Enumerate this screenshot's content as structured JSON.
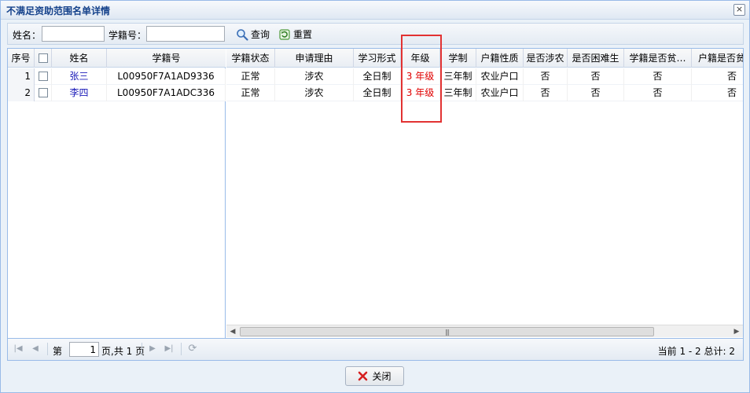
{
  "dialog": {
    "title": "不满足资助范围名单详情",
    "close_icon": "×"
  },
  "search": {
    "name_label": "姓名：",
    "name_value": "",
    "id_label": "学籍号：",
    "id_value": "",
    "query_label": "查询",
    "reset_label": "重置"
  },
  "grid": {
    "frozen_headers": [
      "序号",
      "",
      "姓名",
      "学籍号"
    ],
    "headers": [
      "学籍状态",
      "申请理由",
      "学习形式",
      "年级",
      "学制",
      "户籍性质",
      "是否涉农",
      "是否困难生",
      "学籍是否贫…",
      "户籍是否贫"
    ],
    "rows": [
      {
        "no": "1",
        "name": "张三",
        "student_id": "L00950F7A1AD9336",
        "status": "正常",
        "reason": "涉农",
        "form": "全日制",
        "grade": "3 年级",
        "system": "三年制",
        "household": "农业户口",
        "agri": "否",
        "hardship": "否",
        "reg_poor": "否",
        "hh_poor": "否"
      },
      {
        "no": "2",
        "name": "李四",
        "student_id": "L00950F7A1ADC336",
        "status": "正常",
        "reason": "涉农",
        "form": "全日制",
        "grade": "3 年级",
        "system": "三年制",
        "household": "农业户口",
        "agri": "否",
        "hardship": "否",
        "reg_poor": "否",
        "hh_poor": "否"
      }
    ]
  },
  "pager": {
    "page_prefix": "第",
    "page_value": "1",
    "page_suffix": "页,共 1 页",
    "info": "当前 1 - 2 总计: 2"
  },
  "footer": {
    "close_label": "关闭"
  },
  "colors": {
    "highlight": "#e23232",
    "grade_text": "#e00000",
    "name_link": "#1a1ab8"
  }
}
